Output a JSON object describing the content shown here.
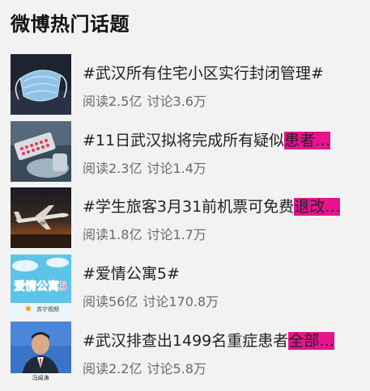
{
  "title": "微博热门话题",
  "topics": [
    {
      "text": "#武汉所有住宅小区实行封闭管理#",
      "highlight": "",
      "read": "阅读2.5亿",
      "discuss": "讨论3.6万",
      "thumb_icon": "face-mask-image"
    },
    {
      "text": "#11日武汉拟将完成所有疑似",
      "highlight": "患者…",
      "read": "阅读2.3亿",
      "discuss": "讨论1.4万",
      "thumb_icon": "lab-test-image"
    },
    {
      "text": "#学生旅客3月31前机票可免费",
      "highlight": "退改…",
      "read": "阅读1.8亿",
      "discuss": "讨论1.7万",
      "thumb_icon": "airplane-image"
    },
    {
      "text": "#爱情公寓5#",
      "highlight": "",
      "read": "阅读56亿",
      "discuss": "讨论170.8万",
      "thumb_icon": "tv-show-poster-image",
      "thumb_text": "爱情公寓5",
      "thumb_brand": "苏宁视频"
    },
    {
      "text": "#武汉排查出1499名重症患者",
      "highlight": "全部…",
      "read": "阅读2.2亿",
      "discuss": "讨论5.8万",
      "thumb_icon": "press-conference-image",
      "thumb_name": "冯闻涛"
    }
  ],
  "colors": {
    "background": "#f2f2f2",
    "highlight": "#e8128f",
    "stats_text": "#6a6a6a"
  }
}
